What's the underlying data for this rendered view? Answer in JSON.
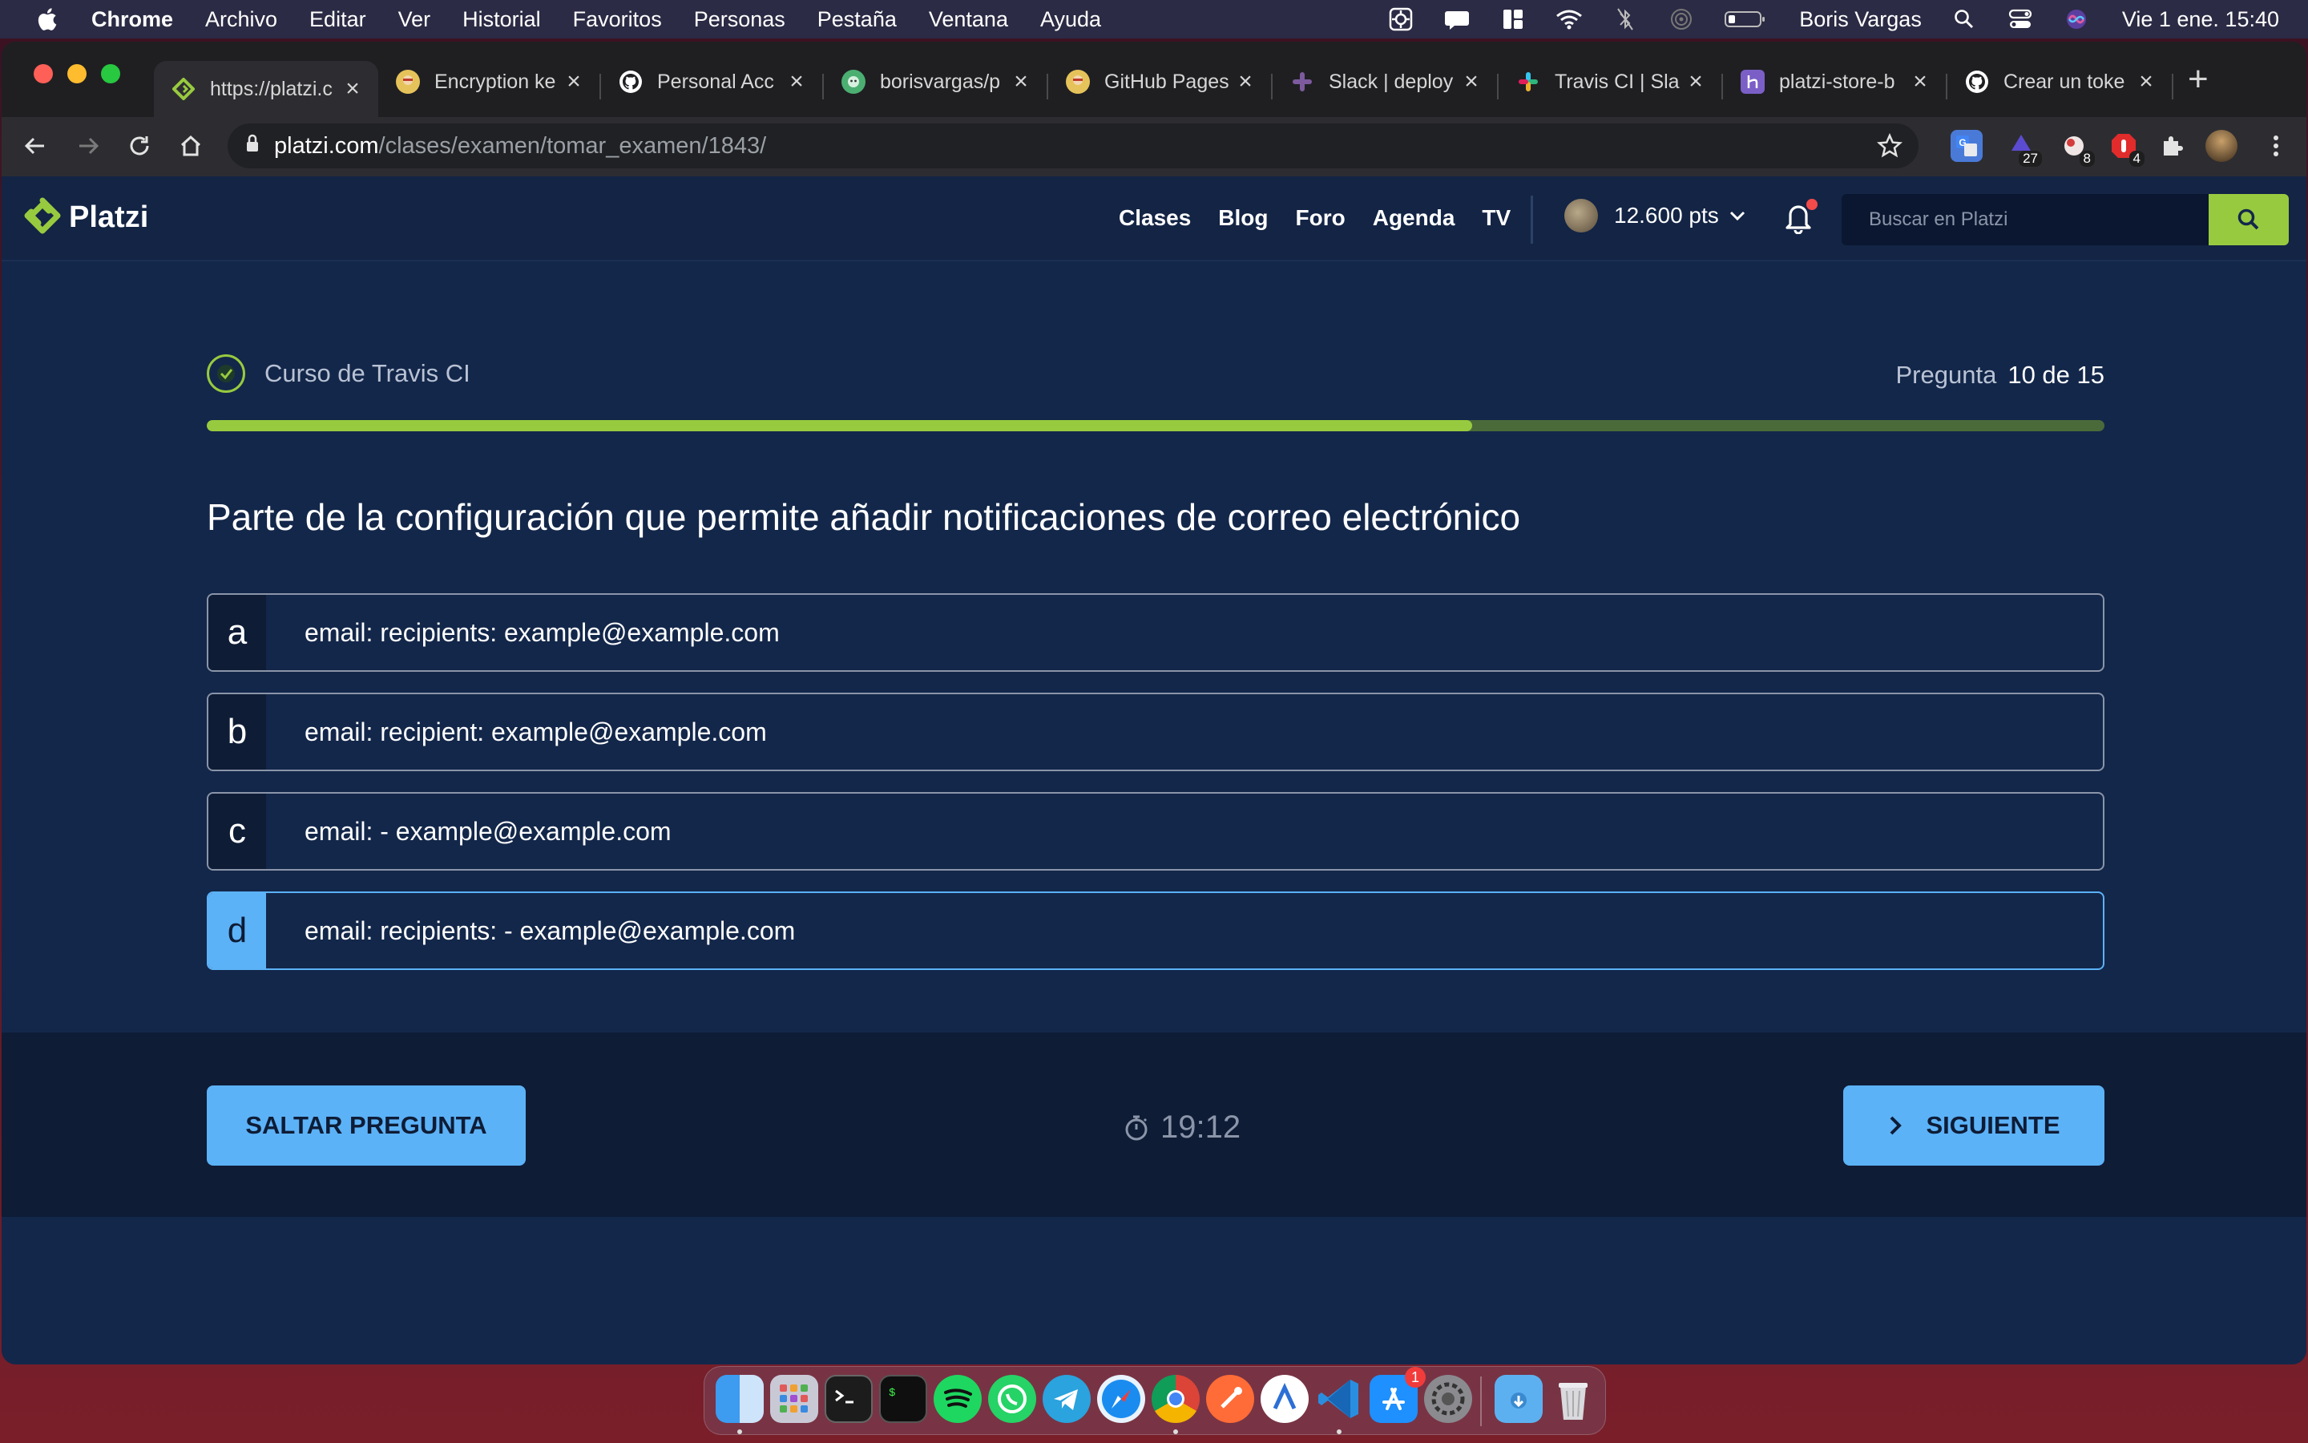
{
  "menubar": {
    "app": "Chrome",
    "items": [
      "Archivo",
      "Editar",
      "Ver",
      "Historial",
      "Favoritos",
      "Personas",
      "Pestaña",
      "Ventana",
      "Ayuda"
    ],
    "user": "Boris Vargas",
    "clock": "Vie 1 ene.  15:40"
  },
  "browser": {
    "tabs": [
      {
        "title": "https://platzi.c",
        "icon": "platzi-icon",
        "active": true
      },
      {
        "title": "Encryption ke",
        "icon": "travis-icon"
      },
      {
        "title": "Personal Acc",
        "icon": "github-icon"
      },
      {
        "title": "borisvargas/p",
        "icon": "octocat-icon"
      },
      {
        "title": "GitHub Pages",
        "icon": "travis-icon"
      },
      {
        "title": "Slack | deploy",
        "icon": "slack-icon"
      },
      {
        "title": "Travis CI | Sla",
        "icon": "slack-icon"
      },
      {
        "title": "platzi-store-b",
        "icon": "heroku-icon"
      },
      {
        "title": "Crear un toke",
        "icon": "github-icon"
      }
    ],
    "url_host": "platzi.com",
    "url_path": "/clases/examen/tomar_examen/1843/",
    "extension_badges": [
      "27",
      "8",
      "4"
    ]
  },
  "header": {
    "logo": "Platzi",
    "nav": [
      "Clases",
      "Blog",
      "Foro",
      "Agenda",
      "TV"
    ],
    "points": "12.600 pts",
    "search_placeholder": "Buscar en Platzi"
  },
  "exam": {
    "course": "Curso de Travis CI",
    "question_label": "Pregunta",
    "question_count": "10 de 15",
    "progress": 0.6667,
    "question": "Parte de la configuración que permite añadir notificaciones de correo electrónico",
    "options": [
      {
        "letter": "a",
        "text": "email: recipients: example@example.com"
      },
      {
        "letter": "b",
        "text": "email: recipient: example@example.com"
      },
      {
        "letter": "c",
        "text": "email: - example@example.com"
      },
      {
        "letter": "d",
        "text": "email: recipients: - example@example.com"
      }
    ],
    "skip_label": "SALTAR PREGUNTA",
    "timer": "19:12",
    "next_label": "SIGUIENTE"
  },
  "dock": {
    "apps": [
      "finder-icon",
      "launchpad-icon",
      "terminal-icon",
      "iterm-icon",
      "spotify-icon",
      "whatsapp-icon",
      "telegram-icon",
      "safari-icon",
      "chrome-icon",
      "postman-icon",
      "notion-icon",
      "vscode-icon",
      "app-store-icon",
      "system-preferences-icon",
      "downloads-folder-icon",
      "trash-icon"
    ],
    "app_store_badge": "1"
  }
}
